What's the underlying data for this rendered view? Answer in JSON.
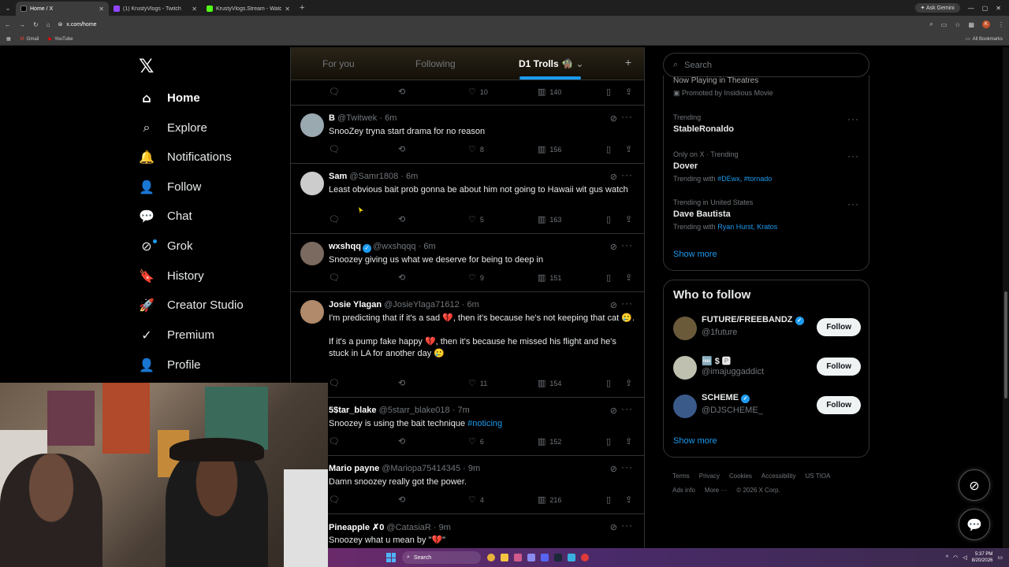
{
  "browser": {
    "tabs": [
      {
        "label": "Home / X",
        "fav_color": "#000000",
        "active": true
      },
      {
        "label": "(1) KrustyVlogs - Twitch",
        "fav_color": "#9146ff",
        "active": false
      },
      {
        "label": "KrustyVlogs.Stream - Watch Liv",
        "fav_color": "#53fc18",
        "active": false
      }
    ],
    "new_tab": "+",
    "ask_gemini": "Ask Gemini",
    "url": "x.com/home",
    "profile_initial": "K",
    "bookmarks": [
      "Gmail",
      "YouTube"
    ],
    "all_bookmarks": "All Bookmarks"
  },
  "nav": {
    "items": [
      {
        "label": "Home",
        "icon": "⌂",
        "name": "home"
      },
      {
        "label": "Explore",
        "icon": "⌕",
        "name": "explore"
      },
      {
        "label": "Notifications",
        "icon": "🔔",
        "name": "notifications"
      },
      {
        "label": "Follow",
        "icon": "👤",
        "name": "follow"
      },
      {
        "label": "Chat",
        "icon": "💬",
        "name": "chat"
      },
      {
        "label": "Grok",
        "icon": "⊘",
        "name": "grok"
      },
      {
        "label": "History",
        "icon": "🔖",
        "name": "history"
      },
      {
        "label": "Creator Studio",
        "icon": "🚀",
        "name": "creator-studio"
      },
      {
        "label": "Premium",
        "icon": "✓",
        "name": "premium"
      },
      {
        "label": "Profile",
        "icon": "👤",
        "name": "profile"
      }
    ]
  },
  "feed": {
    "tabs": [
      "For you",
      "Following",
      "D1 Trolls 🧌"
    ],
    "posts": [
      {
        "name": "",
        "handle": "",
        "time": "",
        "text": "",
        "replies": "",
        "likes": "10",
        "views": "140",
        "avatar_color": "#000"
      },
      {
        "name": "B",
        "handle": "@Twitwek",
        "time": "6m",
        "text": "SnooZey tryna start drama for no reason",
        "likes": "8",
        "views": "156",
        "avatar_color": "#9aa8b0",
        "verified": false
      },
      {
        "name": "Sam",
        "handle": "@Samr1808",
        "time": "6m",
        "text": "Least obvious bait prob gonna be about him not going to Hawaii wit gus watch",
        "likes": "5",
        "views": "163",
        "avatar_color": "#cccccc",
        "verified": false
      },
      {
        "name": "wxshqq",
        "handle": "@wxshqqq",
        "time": "6m",
        "text": "Snoozey giving us what we deserve for being to deep in",
        "likes": "9",
        "views": "151",
        "avatar_color": "#7a6a60",
        "verified": true
      },
      {
        "name": "Josie Ylagan",
        "handle": "@JosieYlaga71612",
        "time": "6m",
        "text": "I'm predicting that if it's a sad 💔, then it's because he's not keeping that cat 🥲.\n\nIf it's a pump fake happy 💔, then it's because he missed his flight and he's stuck in LA for another day 🥲",
        "likes": "11",
        "views": "154",
        "avatar_color": "#b08a6a",
        "verified": false
      },
      {
        "name": "5$tar_blake",
        "handle": "@5starr_blake018",
        "time": "7m",
        "text": "Snoozey is using the bait technique ",
        "hashtag": "#noticing",
        "likes": "6",
        "views": "152",
        "avatar_color": "#000",
        "verified": false
      },
      {
        "name": "Mario payne",
        "handle": "@Mariopa75414345",
        "time": "9m",
        "text": "Damn snoozey really got the power.",
        "likes": "4",
        "views": "216",
        "avatar_color": "#000",
        "verified": false
      },
      {
        "name": "Pineapple ✗0",
        "handle": "@CatasiaR",
        "time": "9m",
        "text": "Snoozey what u mean by \"💔\"",
        "avatar_color": "#000",
        "verified": false
      }
    ]
  },
  "right": {
    "search_placeholder": "Search",
    "promo": {
      "title": "Now Playing in Theatres",
      "promoted": "Promoted by Insidious Movie"
    },
    "trends": [
      {
        "meta": "Trending",
        "title": "StableRonaldo",
        "with": ""
      },
      {
        "meta": "Only on X · Trending",
        "title": "Dover",
        "with_label": "Trending with",
        "with": "#DEwx, #tornado"
      },
      {
        "meta": "Trending in United States",
        "title": "Dave Bautista",
        "with_label": "Trending with",
        "with": "Ryan Hurst, Kratos"
      }
    ],
    "show_more": "Show more",
    "who_to_follow": {
      "title": "Who to follow",
      "users": [
        {
          "name": "FUTURE/FREEBANDZ",
          "handle": "@1future",
          "verified": true,
          "avatar_color": "#6a5a3a"
        },
        {
          "name": "🆓 $ 🅿",
          "handle": "@imajuggaddict",
          "verified": false,
          "avatar_color": "#c0c0b0"
        },
        {
          "name": "SCHEME",
          "handle": "@DJSCHEME_",
          "verified": true,
          "avatar_color": "#3a5a8a"
        }
      ],
      "follow_label": "Follow",
      "show_more": "Show more"
    },
    "footer": [
      "Terms",
      "Privacy",
      "Cookies",
      "Accessibility",
      "US TIOA",
      "Ads info",
      "More ···",
      "© 2026 X Corp."
    ]
  },
  "taskbar": {
    "search": "Search",
    "time": "5:37 PM",
    "date": "8/20/2026"
  }
}
